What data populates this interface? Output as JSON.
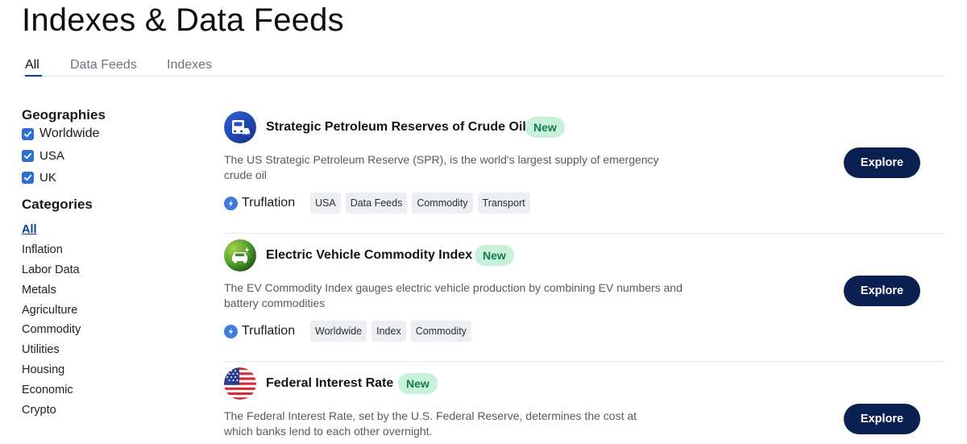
{
  "page": {
    "title": "Indexes & Data Feeds"
  },
  "tabs": [
    {
      "label": "All",
      "active": true
    },
    {
      "label": "Data Feeds",
      "active": false
    },
    {
      "label": "Indexes",
      "active": false
    }
  ],
  "sidebar": {
    "geographies": {
      "heading": "Geographies",
      "items": [
        {
          "label": "Worldwide",
          "checked": true
        },
        {
          "label": "USA",
          "checked": true
        },
        {
          "label": "UK",
          "checked": true
        }
      ]
    },
    "categories": {
      "heading": "Categories",
      "items": [
        {
          "label": "All",
          "active": true
        },
        {
          "label": "Inflation"
        },
        {
          "label": "Labor Data"
        },
        {
          "label": "Metals"
        },
        {
          "label": "Agriculture"
        },
        {
          "label": "Commodity"
        },
        {
          "label": "Utilities"
        },
        {
          "label": "Housing"
        },
        {
          "label": "Economic"
        },
        {
          "label": "Crypto"
        }
      ]
    }
  },
  "cards": [
    {
      "title": "Strategic Petroleum Reserves of Crude Oil",
      "badge": "New",
      "description": "The US Strategic Petroleum Reserve (SPR), is the world's largest supply of emergency crude oil",
      "provider": "Truflation",
      "tags": [
        "USA",
        "Data Feeds",
        "Commodity",
        "Transport"
      ],
      "button": "Explore",
      "icon": "fuel-truck-icon"
    },
    {
      "title": "Electric Vehicle Commodity Index",
      "badge": "New",
      "description": "The EV Commodity Index gauges electric vehicle production by combining EV numbers and battery commodities",
      "provider": "Truflation",
      "tags": [
        "Worldwide",
        "Index",
        "Commodity"
      ],
      "button": "Explore",
      "icon": "electric-car-icon"
    },
    {
      "title": "Federal Interest Rate",
      "badge": "New",
      "description": "The Federal Interest Rate, set by the U.S. Federal Reserve, determines the cost at which banks lend to each other overnight.",
      "provider": "",
      "tags": [],
      "button": "Explore",
      "icon": "us-flag-icon"
    }
  ],
  "colors": {
    "accent": "#0b3d91",
    "button": "#0a2051",
    "badge_bg": "#c8f1dc",
    "badge_text": "#147a4a",
    "checkbox": "#2b6fd6"
  }
}
